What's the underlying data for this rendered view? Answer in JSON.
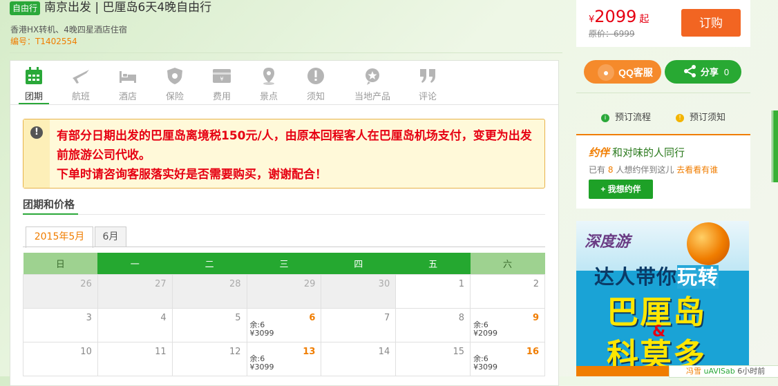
{
  "header": {
    "tag": "自由行",
    "title": "南京出发 | 巴厘岛6天4晚自由行",
    "subtitle": "香港HX转机、4晚四星酒店住宿",
    "code": "编号：T1402554"
  },
  "price_box": {
    "currency": "¥",
    "price": "2099",
    "price_suffix": "起",
    "original": "原价：6999",
    "buy_label": "订购"
  },
  "tabs": [
    {
      "label": "团期",
      "icon": "calendar-icon",
      "active": true
    },
    {
      "label": "航班",
      "icon": "airplane-icon"
    },
    {
      "label": "酒店",
      "icon": "bed-icon"
    },
    {
      "label": "保险",
      "icon": "shield-icon"
    },
    {
      "label": "费用",
      "icon": "money-icon"
    },
    {
      "label": "景点",
      "icon": "location-pin-icon"
    },
    {
      "label": "须知",
      "icon": "warning-icon"
    },
    {
      "label": "当地产品",
      "icon": "local-product-icon"
    },
    {
      "label": "评论",
      "icon": "quote-icon"
    }
  ],
  "notice": {
    "line1": "有部分日期出发的巴厘岛离境税150元/人，由原本回程客人在巴厘岛机场支付，变更为出发前旅游公司代收。",
    "line2": "下单时请咨询客服落实好是否需要购买，谢谢配合！"
  },
  "section_title": "团期和价格",
  "month_tabs": [
    "2015年5月",
    "6月"
  ],
  "calendar": {
    "weekdays": [
      "日",
      "一",
      "二",
      "三",
      "四",
      "五",
      "六"
    ],
    "rows": [
      [
        {
          "d": "26",
          "grey": true
        },
        {
          "d": "27",
          "grey": true
        },
        {
          "d": "28",
          "grey": true
        },
        {
          "d": "29",
          "grey": true
        },
        {
          "d": "30",
          "grey": true
        },
        {
          "d": "1"
        },
        {
          "d": "2"
        }
      ],
      [
        {
          "d": "3"
        },
        {
          "d": "4"
        },
        {
          "d": "5"
        },
        {
          "d": "6",
          "hl": true,
          "left": "余:6",
          "price": "¥3099"
        },
        {
          "d": "7"
        },
        {
          "d": "8"
        },
        {
          "d": "9",
          "hl": true,
          "left": "余:6",
          "price": "¥2099"
        }
      ],
      [
        {
          "d": "10"
        },
        {
          "d": "11"
        },
        {
          "d": "12"
        },
        {
          "d": "13",
          "hl": true,
          "left": "余:6",
          "price": "¥3099"
        },
        {
          "d": "14"
        },
        {
          "d": "15"
        },
        {
          "d": "16",
          "hl": true,
          "left": "余:6",
          "price": "¥3099"
        }
      ]
    ]
  },
  "side": {
    "qq_label": "QQ客服",
    "share_label": "分享",
    "share_count": "0",
    "booking_flow": "预订流程",
    "booking_notes": "预订须知",
    "companion": {
      "logo": "约伴",
      "title": "和对味的人同行",
      "sub_prefix": "已有",
      "count": "8",
      "sub_suffix": "人想约伴到这儿",
      "link": "去看看有谁",
      "button": "+ 我想约伴"
    },
    "ad": {
      "brand": "深度游",
      "headline_a": "达人带你",
      "headline_b": "玩转",
      "dest1": "巴厘岛",
      "amp": "&",
      "dest2": "科莫多"
    },
    "chat": {
      "user": "冯雪",
      "action": "uAVISab",
      "time": "6小时前"
    }
  }
}
